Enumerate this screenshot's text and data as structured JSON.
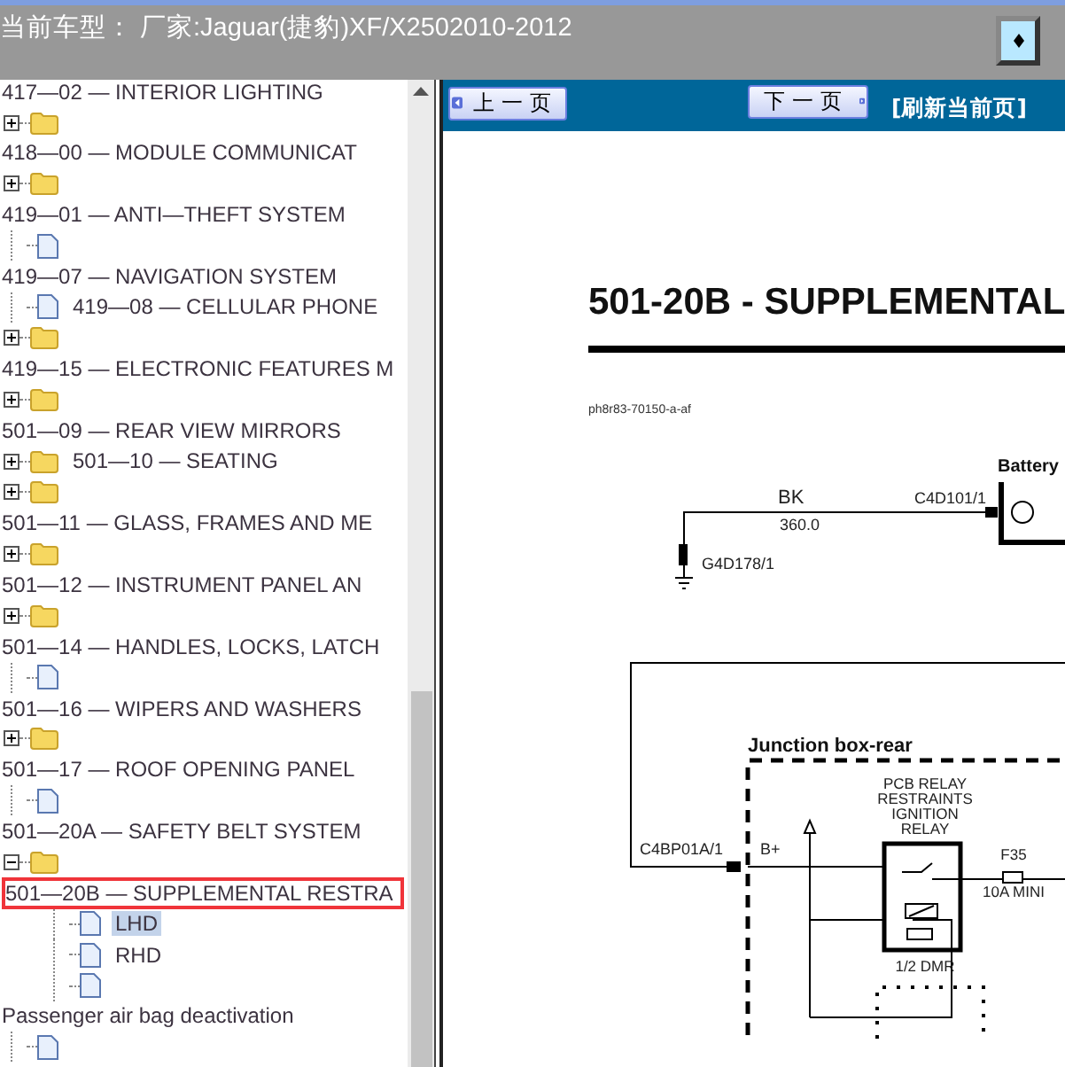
{
  "header": {
    "title": "当前车型： 厂家:Jaguar(捷豹)XF/X2502010-2012"
  },
  "tree": [
    {
      "kind": "text",
      "label": "417—02 — INTERIOR LIGHTING",
      "selected": false,
      "marked": false
    },
    {
      "kind": "folder",
      "expanded": false,
      "selected": false
    },
    {
      "kind": "text",
      "label": "418—00 — MODULE COMMUNICAT",
      "selected": false,
      "marked": false
    },
    {
      "kind": "folder",
      "expanded": false,
      "selected": false
    },
    {
      "kind": "text",
      "label": "419—01 — ANTI—THEFT SYSTEM",
      "selected": false,
      "marked": false
    },
    {
      "kind": "doc",
      "selected": false
    },
    {
      "kind": "text",
      "label": "419—07 — NAVIGATION SYSTEM",
      "selected": false,
      "marked": false
    },
    {
      "kind": "doc",
      "label": "419—08 — CELLULAR PHONE",
      "selected": false
    },
    {
      "kind": "folder",
      "expanded": false,
      "selected": false
    },
    {
      "kind": "text",
      "label": "419—15 — ELECTRONIC FEATURES M",
      "selected": false,
      "marked": false
    },
    {
      "kind": "folder",
      "expanded": false,
      "selected": false
    },
    {
      "kind": "text",
      "label": "501—09 — REAR VIEW MIRRORS",
      "selected": false,
      "marked": false
    },
    {
      "kind": "folder",
      "expanded": false,
      "label": "501—10 — SEATING",
      "selected": false
    },
    {
      "kind": "folder",
      "expanded": false,
      "selected": false
    },
    {
      "kind": "text",
      "label": "501—11 — GLASS, FRAMES AND ME",
      "selected": false,
      "marked": false
    },
    {
      "kind": "folder",
      "expanded": false,
      "selected": false
    },
    {
      "kind": "text",
      "label": "501—12 — INSTRUMENT PANEL AN",
      "selected": false,
      "marked": false
    },
    {
      "kind": "folder",
      "expanded": false,
      "selected": false
    },
    {
      "kind": "text",
      "label": "501—14 — HANDLES, LOCKS, LATCH",
      "selected": false,
      "marked": false
    },
    {
      "kind": "doc",
      "selected": false
    },
    {
      "kind": "text",
      "label": "501—16 — WIPERS AND WASHERS",
      "selected": false,
      "marked": false
    },
    {
      "kind": "folder",
      "expanded": false,
      "selected": false
    },
    {
      "kind": "text",
      "label": "501—17 — ROOF OPENING PANEL",
      "selected": false,
      "marked": false
    },
    {
      "kind": "doc",
      "selected": false
    },
    {
      "kind": "text",
      "label": "501—20A — SAFETY BELT SYSTEM",
      "selected": false,
      "marked": false
    },
    {
      "kind": "folder",
      "expanded": true,
      "selected": false,
      "children": [
        {
          "kind": "text",
          "label": "501—20B — SUPPLEMENTAL RESTRA",
          "selected": false,
          "marked": true
        },
        {
          "kind": "doc",
          "label": "LHD",
          "selected": true
        },
        {
          "kind": "doc",
          "label": "RHD",
          "selected": false
        },
        {
          "kind": "doc",
          "selected": false
        }
      ]
    },
    {
      "kind": "text",
      "label": "Passenger air bag deactivation",
      "selected": false,
      "marked": false
    },
    {
      "kind": "doc",
      "selected": false
    }
  ],
  "toolbar": {
    "prev": "上一页",
    "next": "下一页",
    "refresh": "[刷新当前页]"
  },
  "document": {
    "heading": "501-20B - SUPPLEMENTAL",
    "code": "ph8r83-70150-a-af",
    "diagram": {
      "battery": "Battery",
      "wire_color": "BK",
      "wire_size": "360.0",
      "connector_battery": "C4D101/1",
      "ground": "G4D178/1",
      "junction": "Junction box-rear",
      "relay": [
        "PCB RELAY",
        "RESTRAINTS",
        "IGNITION",
        "RELAY"
      ],
      "bplus": "B+",
      "connector_junction": "C4BP01A/1",
      "fuse": "F35",
      "fuse_rating": "10A MINI",
      "relay_part": "1/2 DMR"
    }
  }
}
